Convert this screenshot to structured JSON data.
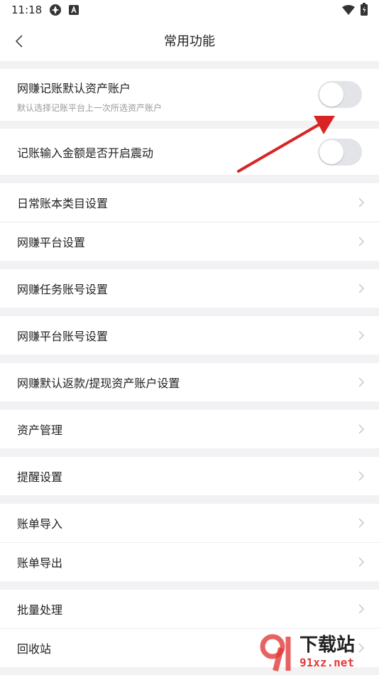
{
  "status_bar": {
    "time": "11:18"
  },
  "nav": {
    "title": "常用功能"
  },
  "toggles": [
    {
      "label": "网赚记账默认资产账户",
      "sublabel": "默认选择记账平台上一次所选资产账户",
      "on": false
    },
    {
      "label": "记账输入金额是否开启震动",
      "on": false
    }
  ],
  "menu": [
    "日常账本类目设置",
    "网赚平台设置",
    "网赚任务账号设置",
    "网赚平台账号设置",
    "网赚默认返款/提现资产账户设置",
    "资产管理",
    "提醒设置",
    "账单导入",
    "账单导出",
    "批量处理",
    "回收站"
  ],
  "watermark": {
    "brand": "下载站",
    "domain": "91xz.net"
  },
  "colors": {
    "annotation_arrow": "#d92424",
    "toggle_off": "#e3e4e8",
    "watermark_red": "#e23b3b"
  }
}
